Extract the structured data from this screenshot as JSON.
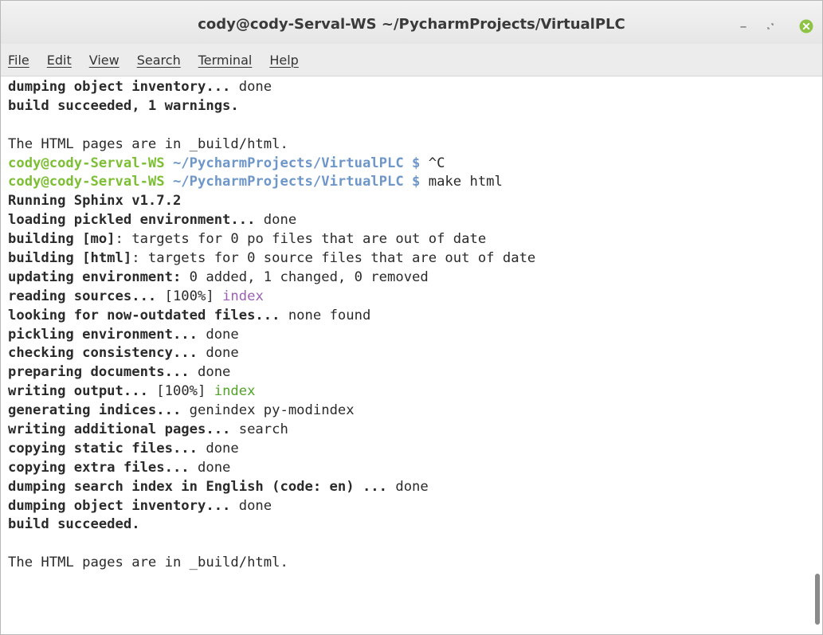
{
  "window": {
    "title": "cody@cody-Serval-WS ~/PycharmProjects/VirtualPLC",
    "controls": {
      "minimize": "–",
      "maximize": "▫",
      "close": "✕"
    }
  },
  "menu": {
    "file": "File",
    "edit": "Edit",
    "view": "View",
    "search": "Search",
    "terminal": "Terminal",
    "help": "Help"
  },
  "terminal": {
    "lines": [
      {
        "bold": "dumping object inventory...",
        "rest": " done"
      },
      {
        "bold": "build succeeded, 1 warnings.",
        "rest": ""
      },
      {
        "bold": "",
        "rest": ""
      },
      {
        "bold": "",
        "rest": "The HTML pages are in _build/html."
      },
      {
        "user": "cody@cody-Serval-WS",
        "path": " ~/PycharmProjects/VirtualPLC $",
        "cmd": " ^C"
      },
      {
        "user": "cody@cody-Serval-WS",
        "path": " ~/PycharmProjects/VirtualPLC $",
        "cmd": " make html"
      },
      {
        "bold": "Running Sphinx v1.7.2",
        "rest": ""
      },
      {
        "bold": "loading pickled environment...",
        "rest": " done"
      },
      {
        "bold": "building [mo]",
        "rest": ": targets for 0 po files that are out of date"
      },
      {
        "bold": "building [html]",
        "rest": ": targets for 0 source files that are out of date"
      },
      {
        "bold": "updating environment:",
        "rest": " 0 added, 1 changed, 0 removed"
      },
      {
        "bold": "reading sources...",
        "rest": " [100%] ",
        "tag": "index"
      },
      {
        "bold": "looking for now-outdated files...",
        "rest": " none found"
      },
      {
        "bold": "pickling environment...",
        "rest": " done"
      },
      {
        "bold": "checking consistency...",
        "rest": " done"
      },
      {
        "bold": "preparing documents...",
        "rest": " done"
      },
      {
        "bold": "writing output...",
        "rest": " [100%] ",
        "tag": "index"
      },
      {
        "bold": "generating indices...",
        "rest": " genindex py-modindex"
      },
      {
        "bold": "writing additional pages...",
        "rest": " search"
      },
      {
        "bold": "copying static files...",
        "rest": " done"
      },
      {
        "bold": "copying extra files...",
        "rest": " done"
      },
      {
        "bold": "dumping search index in English (code: en) ...",
        "rest": " done"
      },
      {
        "bold": "dumping object inventory...",
        "rest": " done"
      },
      {
        "bold": "build succeeded.",
        "rest": ""
      },
      {
        "bold": "",
        "rest": ""
      },
      {
        "bold": "",
        "rest": "The HTML pages are in _build/html."
      }
    ]
  },
  "colors": {
    "prompt_user": "#7cbf33",
    "prompt_path": "#6d96c9",
    "reading_tag": "#9b5fb5",
    "writing_tag": "#52a328",
    "close_button": "#8fc344"
  }
}
